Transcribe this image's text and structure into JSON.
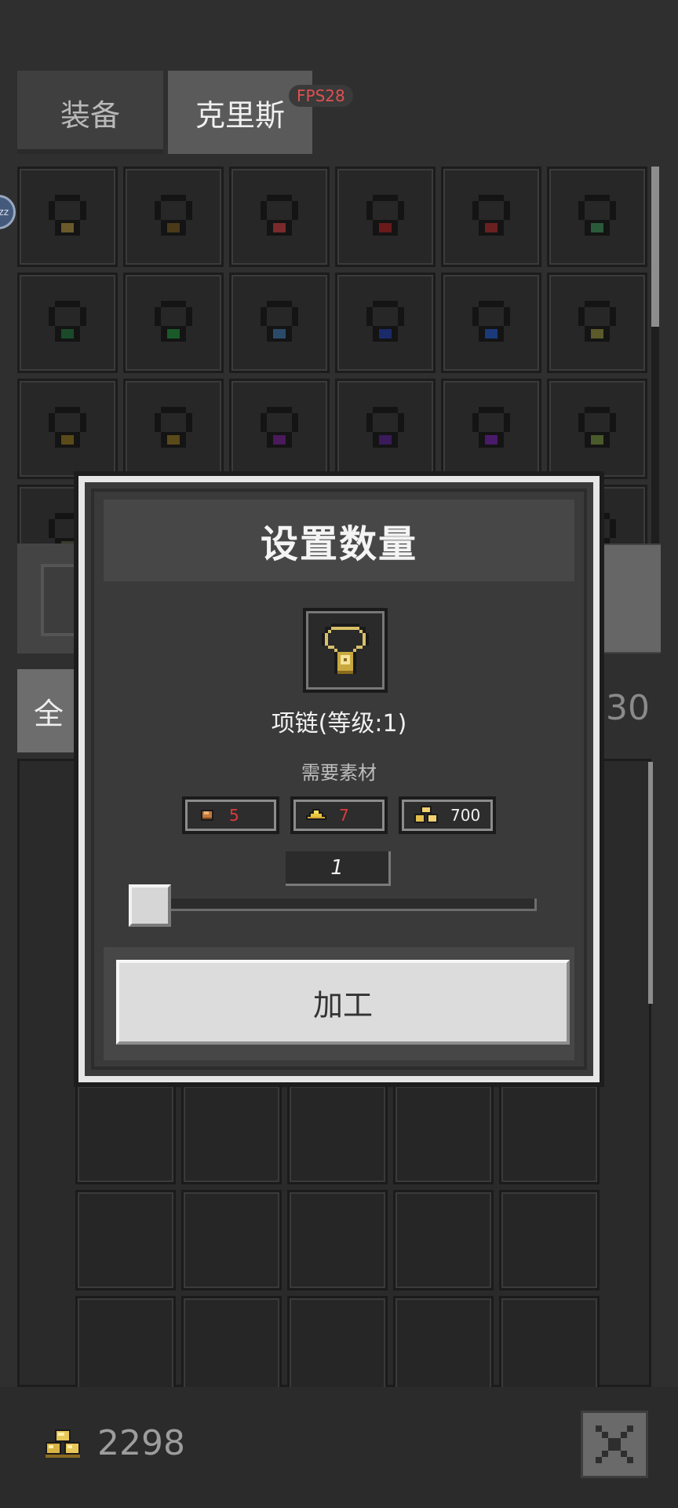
{
  "tabs": [
    {
      "label": "装备"
    },
    {
      "label": "克里斯"
    }
  ],
  "fps": "FPS28",
  "side_badge": "zz",
  "filter": {
    "left_label": "全",
    "right_text": "30"
  },
  "dialog": {
    "title": "设置数量",
    "item_name": "项链(等级:1)",
    "materials_label": "需要素材",
    "materials": [
      {
        "icon": "copper-ore-icon",
        "count": "5",
        "color": "#e03a3a"
      },
      {
        "icon": "gold-ore-icon",
        "count": "7",
        "color": "#e03a3a"
      },
      {
        "icon": "gold-coins-icon",
        "count": "700",
        "color": "#f0f0f0"
      }
    ],
    "quantity": "1",
    "slider_fraction": 0,
    "action_label": "加工"
  },
  "wallet": {
    "gold": "2298"
  },
  "colors": {
    "accent_gold": "#c8a84a",
    "warning_red": "#e03a3a",
    "panel": "#3a3a3a"
  }
}
